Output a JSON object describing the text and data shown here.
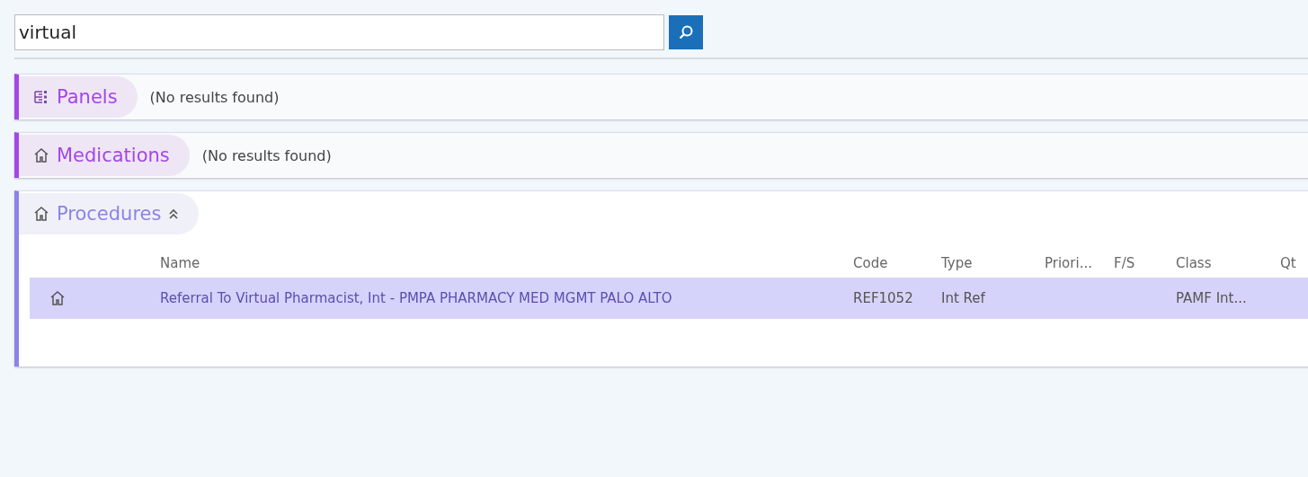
{
  "search": {
    "value": "virtual"
  },
  "sections": [
    {
      "title": "Panels",
      "kind": "list",
      "color": "#a347e8",
      "expanded": false,
      "message": "(No results found)"
    },
    {
      "title": "Medications",
      "kind": "category",
      "color": "#a347e8",
      "expanded": false,
      "message": "(No results found)"
    },
    {
      "title": "Procedures",
      "kind": "category",
      "color": "#8a84e6",
      "expanded": true,
      "table": {
        "columns": [
          "Name",
          "Code",
          "Type",
          "Priori...",
          "F/S",
          "Class",
          "Qt"
        ],
        "rows": [
          {
            "selected": true,
            "name": "Referral To Virtual Pharmacist, Int - PMPA PHARMACY MED MGMT PALO ALTO",
            "code": "REF1052",
            "type": "Int Ref",
            "class": "PAMF Int..."
          }
        ]
      }
    }
  ]
}
